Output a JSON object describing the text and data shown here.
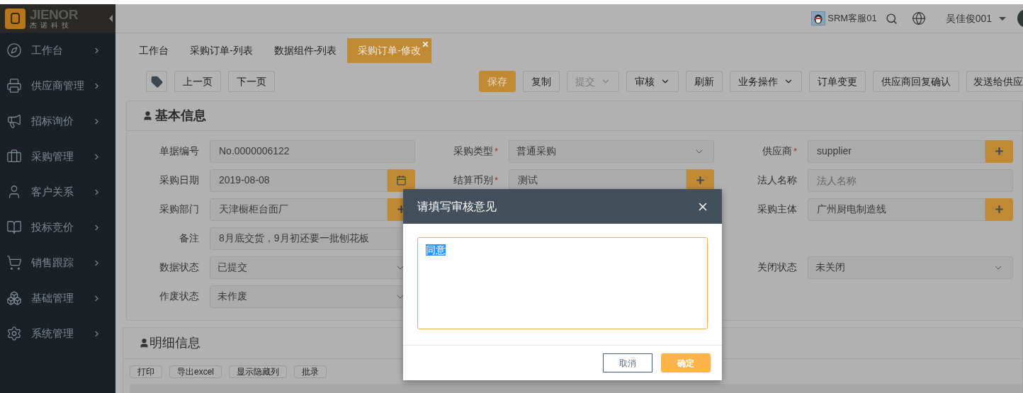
{
  "logo": {
    "brand": "JIENOR",
    "subtitle": "杰诺科技"
  },
  "sidebar": {
    "items": [
      {
        "label": "工作台",
        "kind": "compass"
      },
      {
        "label": "供应商管理",
        "kind": "printer"
      },
      {
        "label": "招标询价",
        "kind": "speaker"
      },
      {
        "label": "采购管理",
        "kind": "briefcase"
      },
      {
        "label": "客户关系",
        "kind": "user"
      },
      {
        "label": "投标竞价",
        "kind": "book"
      },
      {
        "label": "销售跟踪",
        "kind": "cart"
      },
      {
        "label": "基础管理",
        "kind": "boxes"
      },
      {
        "label": "系统管理",
        "kind": "gear"
      }
    ]
  },
  "header": {
    "service": "SRM客服01",
    "user": "吴佳俊001"
  },
  "tabs": [
    {
      "label": "工作台",
      "selected": false
    },
    {
      "label": "采购订单-列表",
      "selected": false
    },
    {
      "label": "数据组件-列表",
      "selected": false
    },
    {
      "label": "采购订单-修改",
      "selected": true
    }
  ],
  "toolbar": {
    "nav": [
      "上一页",
      "下一页"
    ],
    "actions": [
      {
        "label": "保存",
        "kind": "primary",
        "disabled": false
      },
      {
        "label": "复制",
        "kind": "plain",
        "disabled": false
      },
      {
        "label": "提交",
        "kind": "dropdown",
        "disabled": true
      },
      {
        "label": "审核",
        "kind": "dropdown",
        "disabled": false
      },
      {
        "label": "刷新",
        "kind": "plain",
        "disabled": false
      },
      {
        "label": "业务操作",
        "kind": "dropdown",
        "disabled": false
      },
      {
        "label": "订单变更",
        "kind": "plain",
        "disabled": false
      },
      {
        "label": "供应商回复确认",
        "kind": "plain",
        "disabled": false
      },
      {
        "label": "发送给供应",
        "kind": "plain",
        "disabled": false
      }
    ]
  },
  "basic_info": {
    "title": "基本信息",
    "rows": [
      {
        "left": {
          "label": "单据编号",
          "kind": "text",
          "value": "No.0000006122"
        },
        "middle": {
          "label": "采购类型",
          "required_mark": "*",
          "kind": "select",
          "value": "普通采购"
        },
        "right": {
          "label": "供应商",
          "required_mark": "*",
          "kind": "lookup",
          "value": "supplier"
        }
      },
      {
        "left": {
          "label": "采购日期",
          "kind": "date",
          "value": "2019-08-08"
        },
        "middle": {
          "label": "结算币别",
          "required_mark": "*",
          "kind": "lookup",
          "value": "测试"
        },
        "right": {
          "label": "法人名称",
          "kind": "text",
          "placeholder": "法人名称"
        }
      },
      {
        "left": {
          "label": "采购部门",
          "kind": "lookup",
          "value": "天津橱柜台面厂"
        },
        "right": {
          "label": "采购主体",
          "kind": "lookup",
          "value": "广州厨电制造线"
        }
      },
      {
        "left": {
          "label": "备注",
          "kind": "text",
          "value": "8月底交货，9月初还要一批刨花板"
        }
      },
      {
        "left": {
          "label": "数据状态",
          "kind": "select",
          "value": "已提交"
        },
        "right": {
          "label": "关闭状态",
          "kind": "select",
          "value": "未关闭"
        }
      },
      {
        "left": {
          "label": "作废状态",
          "kind": "select",
          "value": "未作废"
        }
      }
    ]
  },
  "detail_info": {
    "title": "明细信息",
    "buttons": [
      "打印",
      "导出excel",
      "显示隐藏列",
      "批录"
    ]
  },
  "dialog": {
    "title": "请填写审核意见",
    "value": "同意",
    "value_selected": true,
    "cancel": "取消",
    "ok": "确定"
  }
}
